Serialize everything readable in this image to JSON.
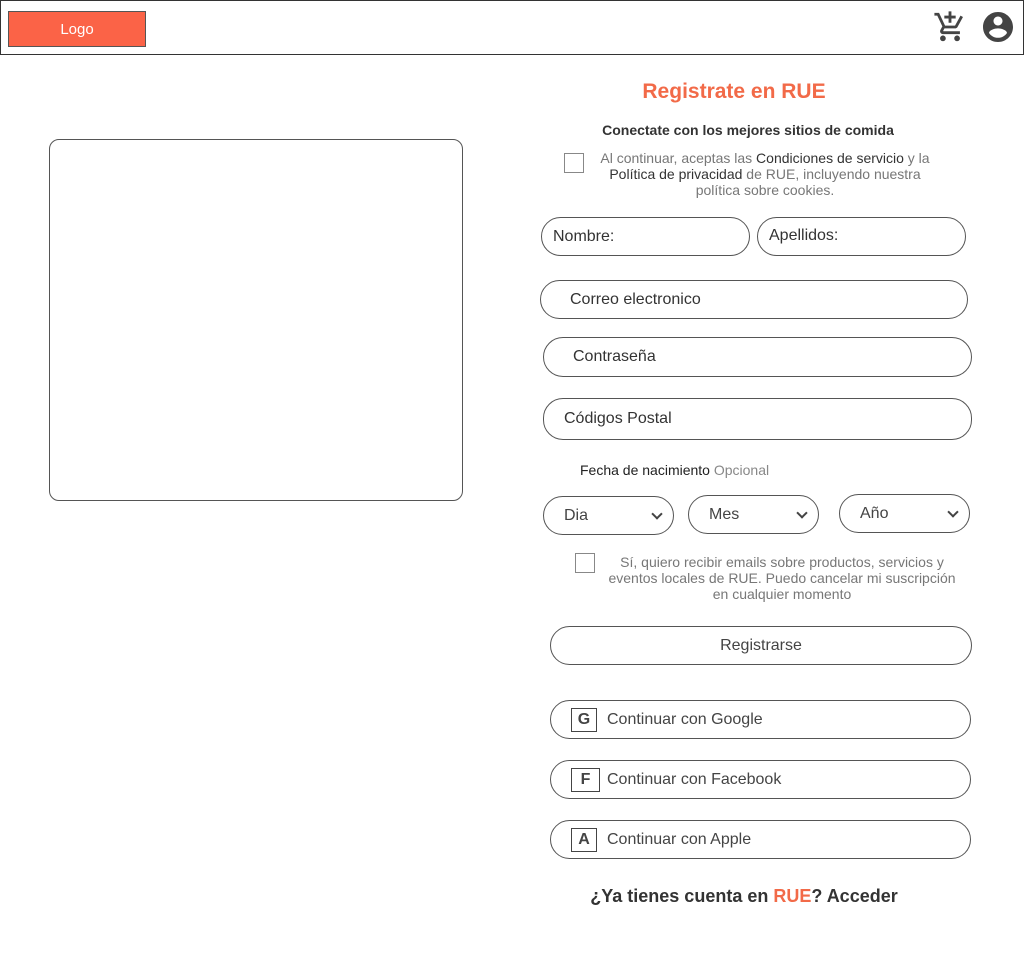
{
  "header": {
    "logo_label": "Logo",
    "icons": [
      "add-shopping-cart-icon",
      "account-circle-icon"
    ]
  },
  "form": {
    "title": "Registrate en RUE",
    "subtitle": "Conectate con los mejores sitios de comida",
    "terms": {
      "prefix": "Al continuar, aceptas las ",
      "link_terms": "Condiciones de servicio",
      "middle": " y la ",
      "link_privacy": "Política de privacidad",
      "suffix": " de RUE, incluyendo nuestra política sobre cookies.",
      "checked": false
    },
    "fields": {
      "first_name": "Nombre:",
      "last_name": "Apellidos:",
      "email": "Correo electronico",
      "password": "Contraseña",
      "postal_code": "Códigos Postal"
    },
    "birthdate": {
      "label": "Fecha de nacimiento",
      "optional": "Opcional",
      "day": "Dia",
      "month": "Mes",
      "year": "Año"
    },
    "marketing": {
      "text": "Sí, quiero recibir emails sobre productos, servicios y eventos locales de RUE. Puedo cancelar mi suscripción en cualquier momento",
      "checked": false
    },
    "register_label": "Registrarse",
    "social": [
      {
        "badge": "G",
        "label": "Continuar con Google"
      },
      {
        "badge": "F",
        "label": "Continuar con Facebook"
      },
      {
        "badge": "A",
        "label": "Continuar con Apple"
      }
    ],
    "footer": {
      "prefix": "¿Ya tienes cuenta en ",
      "brand": "RUE",
      "suffix": "? Acceder"
    }
  },
  "colors": {
    "accent": "#f26a48",
    "logo_bg": "#fb6347",
    "border": "#555555"
  }
}
